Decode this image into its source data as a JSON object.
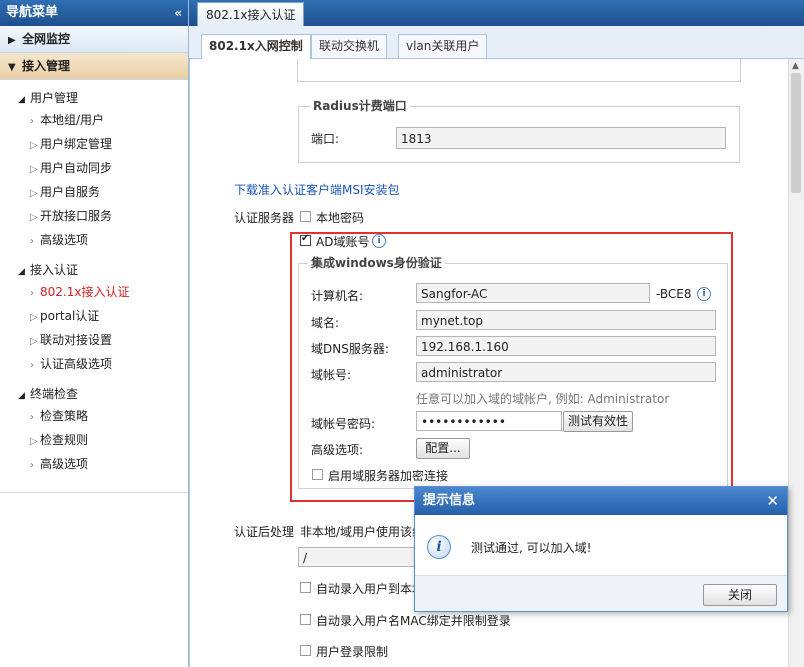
{
  "sidebar": {
    "title": "导航菜单",
    "collapse_glyph": "«",
    "sections": {
      "monitor": "全网监控",
      "access": "接入管理"
    },
    "groups": {
      "user_mgmt": {
        "label": "用户管理",
        "items": [
          "本地组/用户",
          "用户绑定管理",
          "用户自动同步",
          "用户自服务",
          "开放接口服务",
          "高级选项"
        ]
      },
      "access_auth": {
        "label": "接入认证",
        "items": [
          "802.1x接入认证",
          "portal认证",
          "联动对接设置",
          "认证高级选项"
        ]
      },
      "endpoint": {
        "label": "终端检查",
        "items": [
          "检查策略",
          "检查规则",
          "高级选项"
        ]
      }
    }
  },
  "top_tab": "802.1x接入认证",
  "sub_tabs": [
    "802.1x入网控制",
    "联动交换机",
    "vlan关联用户"
  ],
  "radius": {
    "legend": "Radius计费端口",
    "port_label": "端口:",
    "port_value": "1813"
  },
  "download_link": "下载准入认证客户端MSI安装包",
  "auth_server": {
    "label": "认证服务器",
    "local_password": "本地密码",
    "ad_account": "AD域账号"
  },
  "windows_auth": {
    "legend": "集成windows身份验证",
    "computer_name_label": "计算机名:",
    "computer_name_value": "Sangfor-AC",
    "computer_suffix": "-BCE8",
    "domain_label": "域名:",
    "domain_value": "mynet.top",
    "dns_label": "域DNS服务器:",
    "dns_value": "192.168.1.160",
    "account_label": "域帐号:",
    "account_value": "administrator",
    "account_hint": "任意可以加入域的域帐户, 例如: Administrator",
    "password_label": "域帐号密码:",
    "password_value": "••••••••••••",
    "test_button": "测试有效性",
    "advanced_label": "高级选项:",
    "config_button": "配置...",
    "encrypt_label": "启用域服务器加密连接"
  },
  "post_auth": {
    "label": "认证后处理",
    "desc": "非本地/域用户使用该组",
    "group_value": "/",
    "auto_add": "自动录入用户到本地",
    "auto_bind_mac": "自动录入用户名MAC绑定并限制登录",
    "login_limit": "用户登录限制"
  },
  "dialog": {
    "title": "提示信息",
    "close_glyph": "✕",
    "info_glyph": "i",
    "message": "测试通过, 可以加入域!",
    "close_button": "关闭"
  },
  "colors": {
    "nav_blue": "#1d4f8c",
    "active_red": "#d42020",
    "highlight_red": "#e0322e",
    "link_blue": "#1a56b8"
  }
}
